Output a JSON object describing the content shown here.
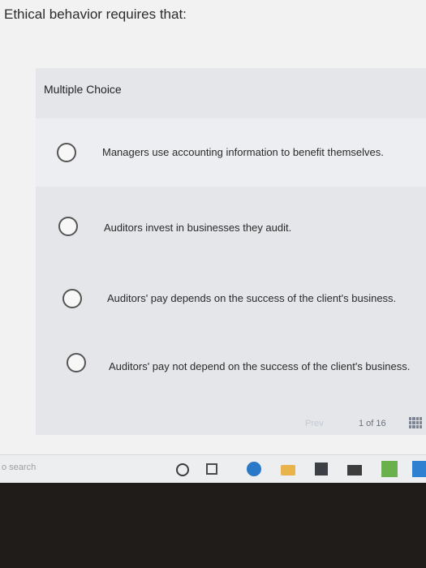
{
  "question": "Ethical behavior requires that:",
  "section_label": "Multiple Choice",
  "options": [
    {
      "text": "Managers use accounting information to benefit themselves."
    },
    {
      "text": "Auditors invest in businesses they audit."
    },
    {
      "text": "Auditors' pay depends on the success of the client's business."
    },
    {
      "text": "Auditors' pay not depend on the success of the client's business."
    }
  ],
  "pagination": {
    "prev_label": "Prev",
    "page_text": "1 of 16"
  },
  "taskbar": {
    "search_text": "o search"
  },
  "icons": {
    "radio": "radio-circle-icon",
    "grid": "grid-icon",
    "cortana": "cortana-circle-icon",
    "task_view": "task-view-icon",
    "edge": "edge-browser-icon",
    "folder": "file-explorer-icon",
    "store": "store-icon",
    "mail": "mail-icon"
  }
}
